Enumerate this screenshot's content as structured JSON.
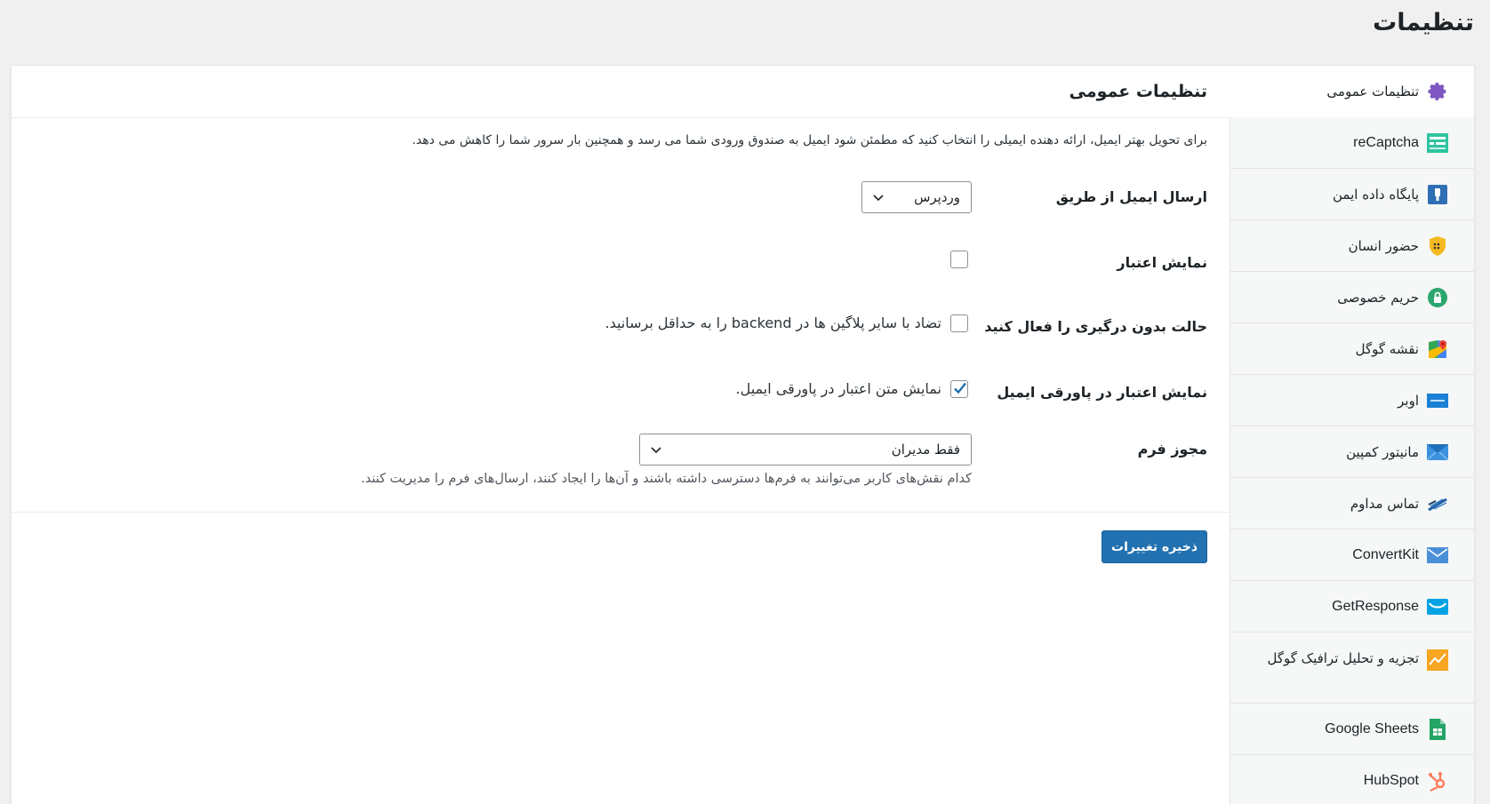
{
  "page": {
    "title": "تنظیمات"
  },
  "sidebar": {
    "items": [
      {
        "label": "تنظیمات عمومی",
        "icon": "gear-icon",
        "active": true
      },
      {
        "label": "reCaptcha",
        "icon": "recaptcha-icon"
      },
      {
        "label": "پایگاه داده ایمن",
        "icon": "database-lock-icon"
      },
      {
        "label": "حضور انسان",
        "icon": "shield-icon"
      },
      {
        "label": "حریم خصوصی",
        "icon": "privacy-lock-icon"
      },
      {
        "label": "نقشه گوگل",
        "icon": "google-maps-icon"
      },
      {
        "label": "اوبر",
        "icon": "aweber-icon"
      },
      {
        "label": "مانیتور کمپین",
        "icon": "campaign-monitor-icon"
      },
      {
        "label": "تماس مداوم",
        "icon": "constant-contact-icon"
      },
      {
        "label": "ConvertKit",
        "icon": "convertkit-icon"
      },
      {
        "label": "GetResponse",
        "icon": "getresponse-icon"
      },
      {
        "label": "تجزیه و تحلیل ترافیک گوگل",
        "icon": "analytics-icon"
      },
      {
        "label": "Google Sheets",
        "icon": "google-sheets-icon"
      },
      {
        "label": "HubSpot",
        "icon": "hubspot-icon"
      }
    ]
  },
  "main": {
    "section_title": "تنظیمات عمومی",
    "intro": "برای تحویل بهتر ایمیل، ارائه دهنده ایمیلی را انتخاب کنید که مطمئن شود ایمیل به صندوق ورودی شما می رسد و همچنین بار سرور شما را کاهش می دهد.",
    "send_email_via": {
      "label": "ارسال ایمیل از طریق",
      "value": "وردپرس"
    },
    "show_credit": {
      "label": "نمایش اعتبار",
      "checked": false
    },
    "conflict_mode": {
      "label": "حالت بدون درگیری را فعال کنید",
      "text": "تضاد با سایر پلاگین ها در backend را به حداقل برسانید.",
      "checked": false
    },
    "credit_footer": {
      "label": "نمایش اعتبار در پاورقی ایمیل",
      "text": "نمایش متن اعتبار در پاورقی ایمیل.",
      "checked": true
    },
    "form_permission": {
      "label": "مجوز فرم",
      "value": "فقط مدیران",
      "help": "کدام نقش‌های کاربر می‌توانند به فرم‌ها دسترسی داشته باشند و آن‌ها را ایجاد کنند، ارسال‌های فرم را مدیریت کنند."
    },
    "save_label": "ذخیره تغییرات"
  },
  "colors": {
    "accent": "#2271b1",
    "gear": "#7e57c2",
    "recaptcha": "#2ec4a0",
    "shield": "#f5b921",
    "privacy": "#2ca66f",
    "analytics": "#f6a623",
    "sheets": "#23a566",
    "hubspot": "#ff7a59"
  }
}
